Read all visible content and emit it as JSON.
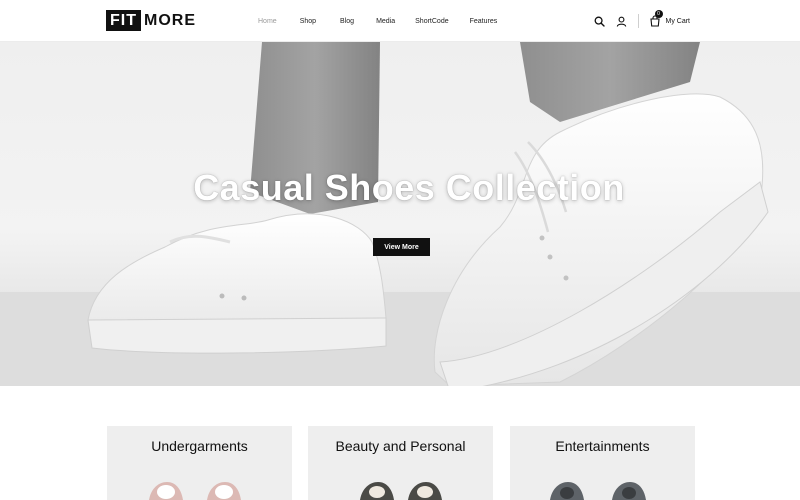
{
  "brand": {
    "logo_part1": "FIT",
    "logo_part2": "MORE"
  },
  "nav": {
    "items": [
      {
        "label": "Home",
        "active": true
      },
      {
        "label": "Shop",
        "active": false
      },
      {
        "label": "Blog",
        "active": false
      },
      {
        "label": "Media",
        "active": false
      },
      {
        "label": "ShortCode",
        "active": false
      },
      {
        "label": "Features",
        "active": false
      }
    ]
  },
  "header": {
    "icons": [
      "search-icon",
      "user-icon",
      "cart-icon"
    ],
    "cart_count": "0",
    "cart_label": "My Cart"
  },
  "hero": {
    "title": "Casual Shoes Collection",
    "button_label": "View More"
  },
  "categories": [
    {
      "title": "Undergarments",
      "shoe_color": "#dcb9b4"
    },
    {
      "title": "Beauty and Personal",
      "shoe_color": "#4a4a46"
    },
    {
      "title": "Entertainments",
      "shoe_color": "#5e6368"
    }
  ],
  "colors": {
    "accent": "#111111",
    "hero_bg": "#efefef",
    "card_bg": "#eeeeee"
  }
}
